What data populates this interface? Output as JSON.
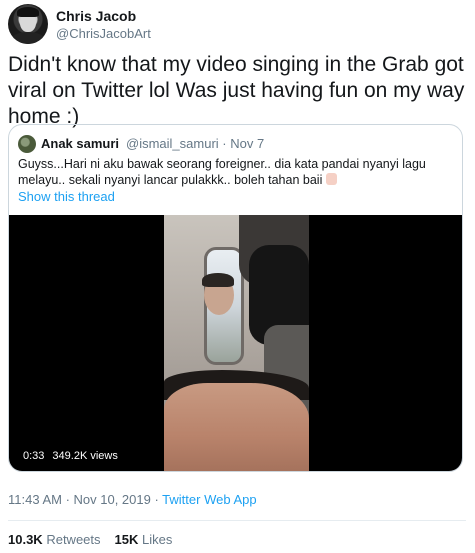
{
  "author": {
    "name": "Chris Jacob",
    "handle": "@ChrisJacobArt"
  },
  "tweet": {
    "text": "Didn't know that my video singing in the Grab got viral on Twitter lol Was just having fun on my way home :)"
  },
  "quoted": {
    "name": "Anak samuri",
    "meta": "@ismail_samuri · Nov 7",
    "text": "Guyss...Hari ni aku  bawak seorang foreigner.. dia kata pandai nyanyi lagu melayu.. sekali nyanyi lancar pulakkk.. boleh tahan baii",
    "show_thread": "Show this thread",
    "video": {
      "duration": "0:33",
      "views": "349.2K views"
    }
  },
  "timestamp": {
    "datetime": "11:43 AM · Nov 10, 2019 · ",
    "app": "Twitter Web App"
  },
  "stats": {
    "retweets_count": "10.3K",
    "retweets_label": "Retweets",
    "likes_count": "15K",
    "likes_label": "Likes"
  },
  "colors": {
    "accent": "#1da1f2",
    "muted": "#657786",
    "text": "#14171a"
  }
}
